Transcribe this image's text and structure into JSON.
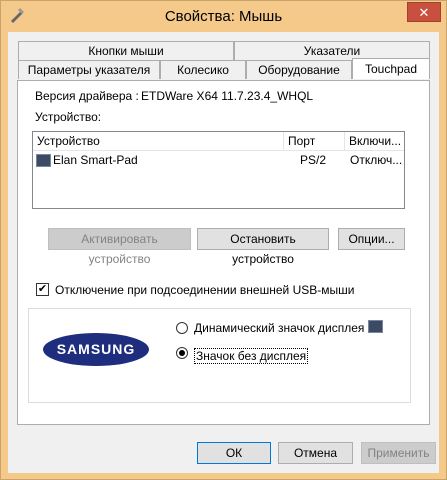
{
  "window": {
    "title": "Свойства: Мышь",
    "close_glyph": "✕"
  },
  "tabs": {
    "row_top": [
      "Кнопки мыши",
      "Указатели"
    ],
    "row_bottom": [
      "Параметры указателя",
      "Колесико",
      "Оборудование",
      "Touchpad"
    ],
    "active": "Touchpad"
  },
  "driver": {
    "label": "Версия драйвера :",
    "value": "ETDWare X64 11.7.23.4_WHQL"
  },
  "devices": {
    "label": "Устройство:",
    "columns": [
      "Устройство",
      "Порт",
      "Включи..."
    ],
    "rows": [
      {
        "name": "Elan Smart-Pad",
        "port": "PS/2",
        "enabled": "Отключ..."
      }
    ]
  },
  "device_buttons": {
    "activate": "Активировать устройство",
    "stop": "Остановить устройство",
    "options": "Опции..."
  },
  "usb_checkbox": {
    "label": "Отключение при подсоединении внешней USB-мыши",
    "checked": true,
    "mark": "✔"
  },
  "icon_group": {
    "logo_text": "SAMSUNG",
    "radio_dynamic": "Динамический значок дисплея",
    "radio_static": "Значок без дисплея",
    "selected": "static"
  },
  "footer": {
    "ok": "ОК",
    "cancel": "Отмена",
    "apply": "Применить"
  },
  "colors": {
    "frame": "#f4c98a",
    "close": "#c7503f",
    "logo": "#1e2d7d"
  }
}
